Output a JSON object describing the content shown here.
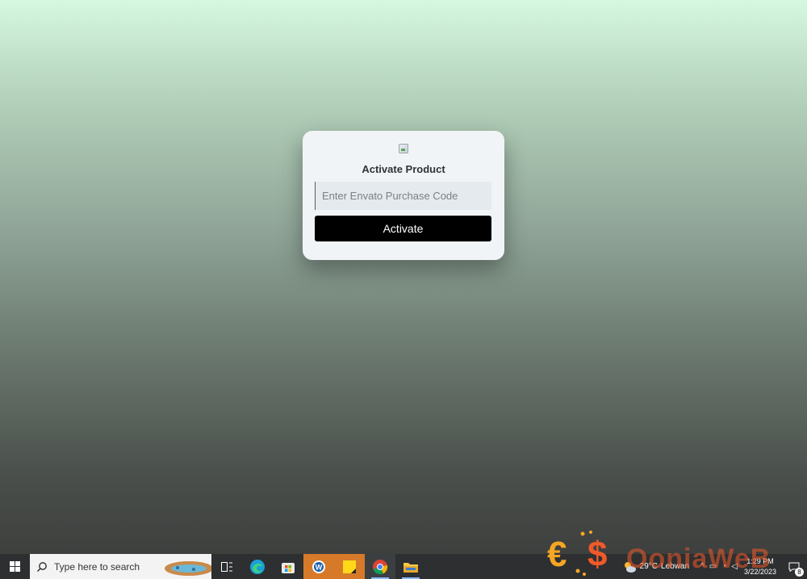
{
  "card": {
    "title": "Activate Product",
    "input_placeholder": "Enter Envato Purchase Code",
    "input_value": "",
    "button_label": "Activate"
  },
  "taskbar": {
    "search_placeholder": "Type here to search",
    "apps": [
      {
        "name": "task-view-icon"
      },
      {
        "name": "edge-icon"
      },
      {
        "name": "store-icon"
      },
      {
        "name": "app-w-icon"
      },
      {
        "name": "sticky-notes-icon"
      },
      {
        "name": "chrome-icon"
      },
      {
        "name": "file-explorer-icon"
      }
    ],
    "weather": {
      "temperature": "29°C",
      "condition": "Lebwan"
    },
    "clock": {
      "time": "1:29 PM",
      "date": "3/22/2023"
    },
    "notification_count": "8"
  },
  "watermark": {
    "text": "OoniaWeB"
  },
  "colors": {
    "button_bg": "#000000",
    "card_bg": "#f1f4f6",
    "taskbar_bg": "#2d2f31",
    "watermark": "#f05a28"
  }
}
